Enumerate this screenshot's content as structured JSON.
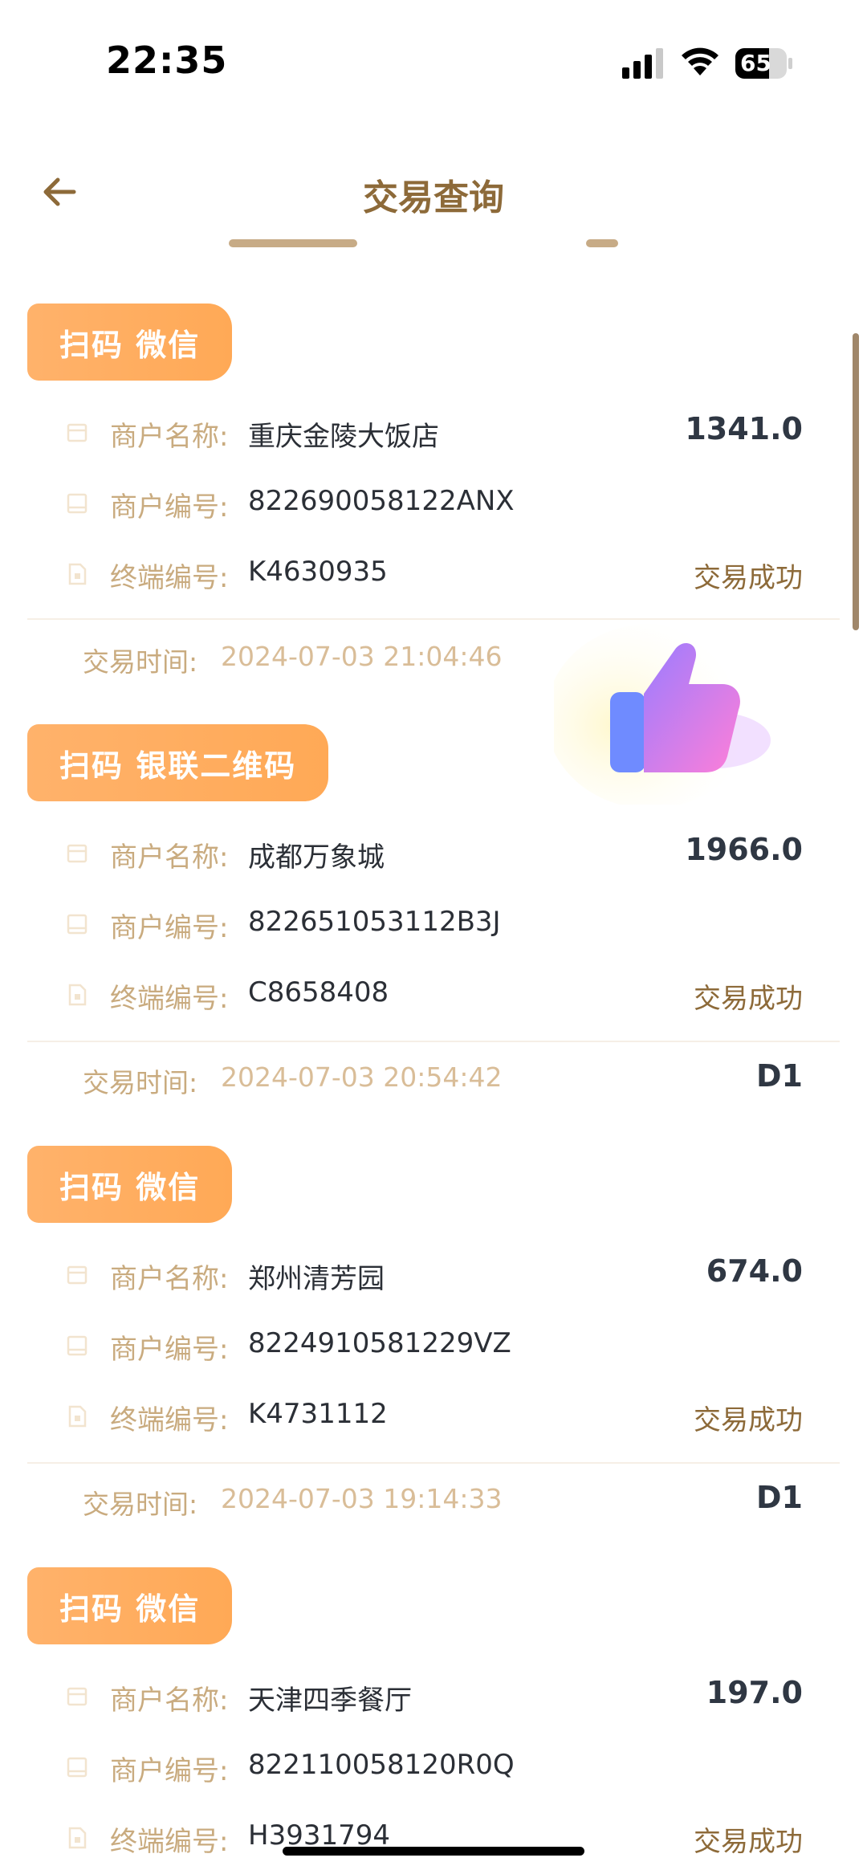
{
  "status_bar": {
    "time": "22:35",
    "battery": "65"
  },
  "header": {
    "title": "交易查询"
  },
  "labels": {
    "merchant_name": "商户名称:",
    "merchant_no": "商户编号:",
    "terminal_no": "终端编号:",
    "trade_time": "交易时间:"
  },
  "transactions": [
    {
      "tag": "扫码  微信",
      "merchant_name": "重庆金陵大饭店",
      "amount": "1341.0",
      "merchant_no": "822690058122ANX",
      "terminal_no": "K4630935",
      "status": "交易成功",
      "time": "2024-07-03 21:04:46",
      "settle": ""
    },
    {
      "tag": "扫码  银联二维码",
      "merchant_name": "成都万象城",
      "amount": "1966.0",
      "merchant_no": "822651053112B3J",
      "terminal_no": "C8658408",
      "status": "交易成功",
      "time": "2024-07-03 20:54:42",
      "settle": "D1"
    },
    {
      "tag": "扫码  微信",
      "merchant_name": "郑州清芳园",
      "amount": "674.0",
      "merchant_no": "8224910581229VZ",
      "terminal_no": "K4731112",
      "status": "交易成功",
      "time": "2024-07-03 19:14:33",
      "settle": "D1"
    },
    {
      "tag": "扫码  微信",
      "merchant_name": "天津四季餐厅",
      "amount": "197.0",
      "merchant_no": "822110058120R0Q",
      "terminal_no": "H3931794",
      "status": "交易成功",
      "time": "",
      "settle": ""
    }
  ],
  "colors": {
    "accent": "#ffa956",
    "brown": "#8d6a39",
    "label": "#c9ab7f"
  },
  "icons": [
    "back-arrow-icon",
    "store-icon",
    "id-card-icon",
    "document-icon",
    "thumbs-up-icon"
  ]
}
